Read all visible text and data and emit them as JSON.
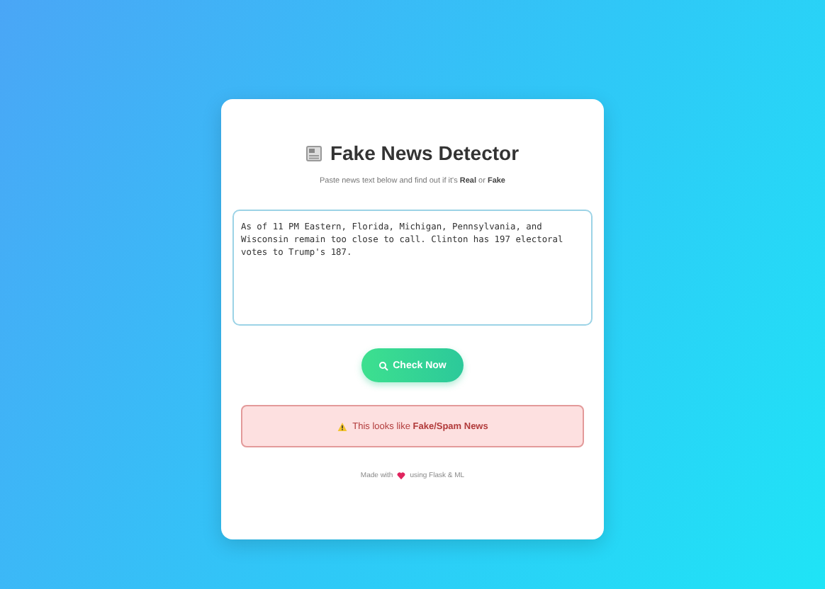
{
  "card": {
    "title": "Fake News Detector",
    "subtitle": "Paste news text below and find out if it's **Real** or **Fake**",
    "news_text": {
      "value": "As of 11 PM Eastern, Florida, Michigan, Pennsylvania, and Wisconsin remain too close to call. Clinton has 197 electoral votes to Trump's 187."
    },
    "button": {
      "label": "Check Now"
    },
    "result": {
      "kind": "fake",
      "text": "This looks like **Fake/Spam News**"
    },
    "footer": {
      "before": "Made with",
      "after": "using Flask & ML"
    }
  }
}
